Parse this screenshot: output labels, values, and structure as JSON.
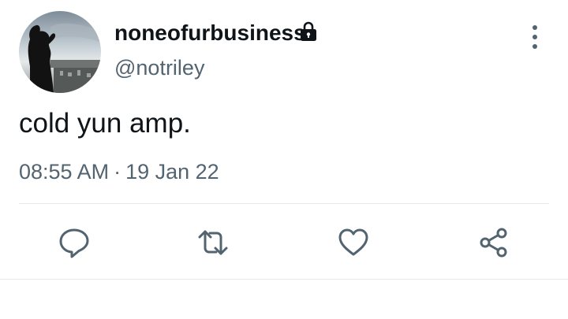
{
  "tweet": {
    "display_name": "noneofurbusiness",
    "handle": "@notriley",
    "text": "cold yun amp.",
    "time": "08:55 AM",
    "separator": "·",
    "date": "19 Jan 22"
  },
  "icons": {
    "verified_or_protected": "lock-icon",
    "menu": "more-vertical-icon",
    "actions": [
      "reply-icon",
      "retweet-icon",
      "like-icon",
      "share-icon"
    ]
  },
  "colors": {
    "text_primary": "#0f1419",
    "text_secondary": "#536471",
    "icon": "#536471",
    "divider": "#e6e9eb"
  }
}
